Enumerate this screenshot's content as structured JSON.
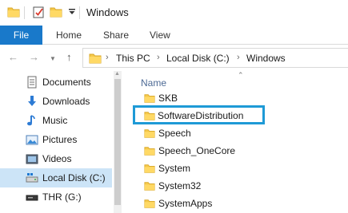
{
  "window": {
    "title": "Windows"
  },
  "ribbon": {
    "tabs": [
      "File",
      "Home",
      "Share",
      "View"
    ]
  },
  "address": {
    "crumbs": [
      "This PC",
      "Local Disk (C:)",
      "Windows"
    ]
  },
  "nav_pane": {
    "items": [
      {
        "label": "Documents",
        "icon": "documents-icon"
      },
      {
        "label": "Downloads",
        "icon": "downloads-icon"
      },
      {
        "label": "Music",
        "icon": "music-icon"
      },
      {
        "label": "Pictures",
        "icon": "pictures-icon"
      },
      {
        "label": "Videos",
        "icon": "videos-icon"
      },
      {
        "label": "Local Disk (C:)",
        "icon": "local-disk-icon",
        "selected": true
      },
      {
        "label": "THR (G:)",
        "icon": "drive-icon"
      }
    ]
  },
  "content": {
    "column_header": "Name",
    "files": [
      {
        "name": "SKB"
      },
      {
        "name": "SoftwareDistribution",
        "highlighted": true
      },
      {
        "name": "Speech"
      },
      {
        "name": "Speech_OneCore"
      },
      {
        "name": "System"
      },
      {
        "name": "System32"
      },
      {
        "name": "SystemApps"
      }
    ]
  },
  "colors": {
    "file_tab": "#1979ca",
    "folder": "#f5c94a",
    "selection": "#cce4f7",
    "highlight_border": "#1e9ad6"
  }
}
